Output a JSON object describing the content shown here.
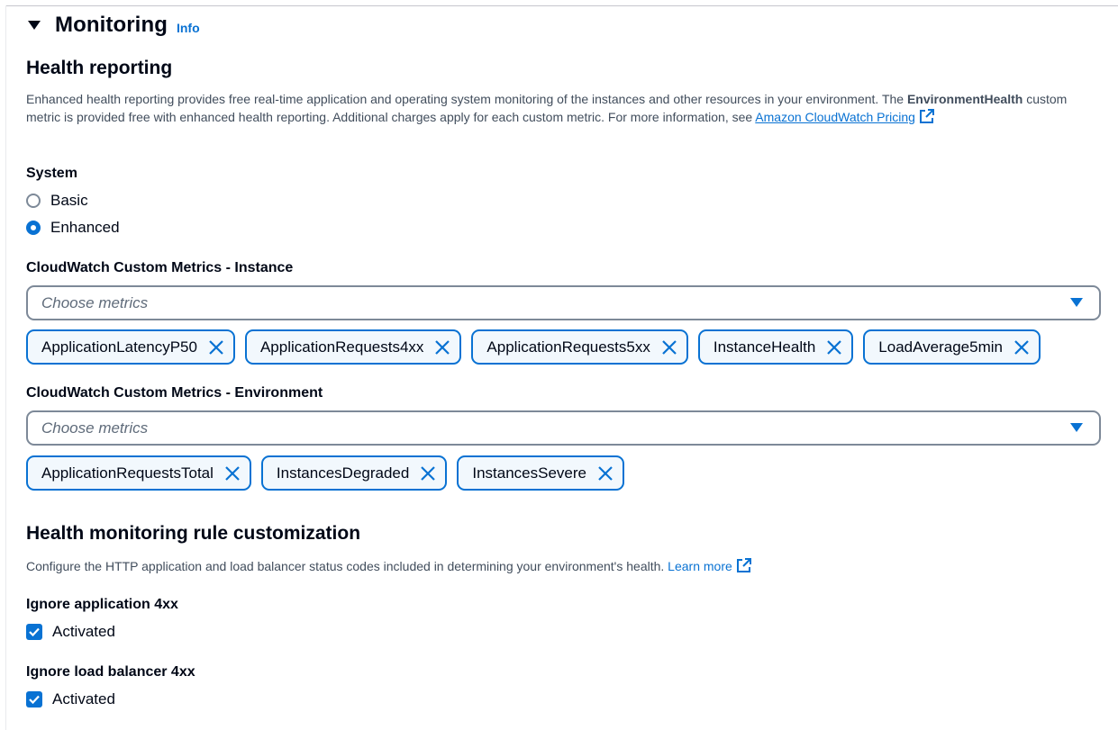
{
  "section": {
    "title": "Monitoring",
    "info_label": "Info"
  },
  "health_reporting": {
    "heading": "Health reporting",
    "description_part1": "Enhanced health reporting provides free real-time application and operating system monitoring of the instances and other resources in your environment. The ",
    "description_bold": "EnvironmentHealth",
    "description_part2": " custom metric is provided free with enhanced health reporting. Additional charges apply for each custom metric. For more information, see ",
    "pricing_link": "Amazon CloudWatch Pricing",
    "system_label": "System",
    "options": [
      {
        "label": "Basic",
        "selected": false
      },
      {
        "label": "Enhanced",
        "selected": true
      }
    ],
    "instance_metrics": {
      "label": "CloudWatch Custom Metrics - Instance",
      "placeholder": "Choose metrics",
      "tokens": [
        "ApplicationLatencyP50",
        "ApplicationRequests4xx",
        "ApplicationRequests5xx",
        "InstanceHealth",
        "LoadAverage5min"
      ]
    },
    "environment_metrics": {
      "label": "CloudWatch Custom Metrics - Environment",
      "placeholder": "Choose metrics",
      "tokens": [
        "ApplicationRequestsTotal",
        "InstancesDegraded",
        "InstancesSevere"
      ]
    }
  },
  "rule_customization": {
    "heading": "Health monitoring rule customization",
    "description": "Configure the HTTP application and load balancer status codes included in determining your environment's health. ",
    "learn_more": "Learn more",
    "ignore_app_4xx": {
      "label": "Ignore application 4xx",
      "check_label": "Activated",
      "checked": true
    },
    "ignore_lb_4xx": {
      "label": "Ignore load balancer 4xx",
      "check_label": "Activated",
      "checked": true
    }
  },
  "colors": {
    "accent": "#0972d3",
    "text": "#000716",
    "muted": "#414d5c",
    "token_bg": "#f2f8fd"
  }
}
